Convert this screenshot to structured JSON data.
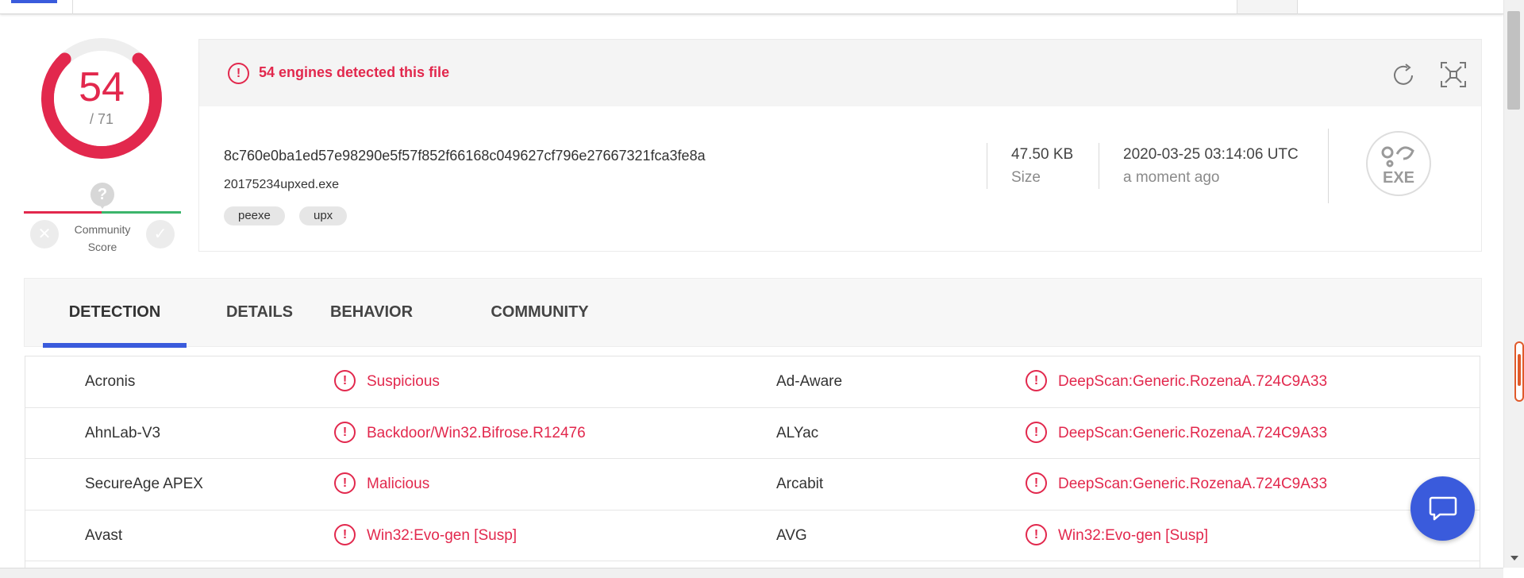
{
  "score": {
    "detections": "54",
    "total": "/ 71",
    "detected_fraction": 0.76
  },
  "community": {
    "question_icon": "question-icon",
    "label_line1": "Community",
    "label_line2": "Score"
  },
  "header": {
    "alert_text": "54 engines detected this file",
    "refresh_icon": "refresh-icon",
    "collapse_icon": "collapse-icon"
  },
  "file": {
    "hash": "8c760e0ba1ed57e98290e5f57f852f66168c049627cf796e27667321fca3fe8a",
    "name": "20175234upxed.exe",
    "tags": [
      "peexe",
      "upx"
    ],
    "size_value": "47.50 KB",
    "size_label": "Size",
    "date_value": "2020-03-25 03:14:06 UTC",
    "date_label": "a moment ago",
    "type_icon_text": "EXE"
  },
  "tabs": [
    {
      "label": "DETECTION",
      "active": true
    },
    {
      "label": "DETAILS",
      "active": false
    },
    {
      "label": "BEHAVIOR",
      "active": false
    },
    {
      "label": "COMMUNITY",
      "active": false
    }
  ],
  "detections": [
    {
      "left_engine": "Acronis",
      "left_result": "Suspicious",
      "right_engine": "Ad-Aware",
      "right_result": "DeepScan:Generic.RozenaA.724C9A33"
    },
    {
      "left_engine": "AhnLab-V3",
      "left_result": "Backdoor/Win32.Bifrose.R12476",
      "right_engine": "ALYac",
      "right_result": "DeepScan:Generic.RozenaA.724C9A33"
    },
    {
      "left_engine": "SecureAge APEX",
      "left_result": "Malicious",
      "right_engine": "Arcabit",
      "right_result": "DeepScan:Generic.RozenaA.724C9A33"
    },
    {
      "left_engine": "Avast",
      "left_result": "Win32:Evo-gen [Susp]",
      "right_engine": "AVG",
      "right_result": "Win32:Evo-gen [Susp]"
    }
  ],
  "colors": {
    "malicious": "#e2284d",
    "accent": "#3a5bdc",
    "positive": "#3cb56b"
  },
  "chat_icon": "chat-icon"
}
